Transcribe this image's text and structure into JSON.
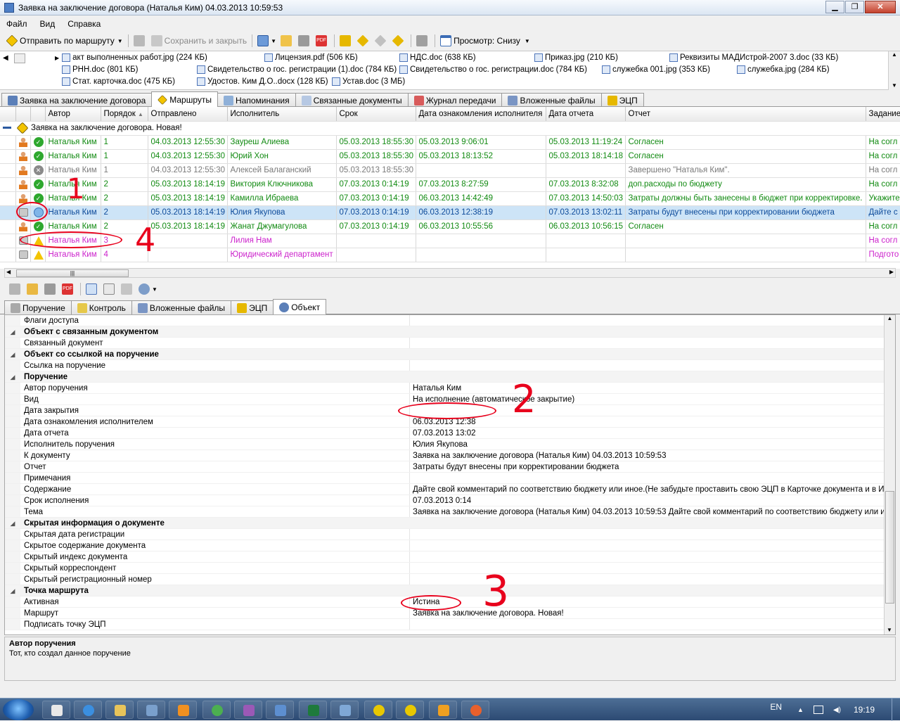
{
  "window": {
    "title": "Заявка на заключение договора (Наталья Ким) 04.03.2013 10:59:53"
  },
  "menu": [
    "Файл",
    "Вид",
    "Справка"
  ],
  "toolbar": {
    "send_route": "Отправить по маршруту",
    "save_close": "Сохранить и закрыть",
    "view": "Просмотр: Снизу"
  },
  "attachments": [
    {
      "name": "акт выполненных работ.jpg (224 КБ)"
    },
    {
      "name": "Лицензия.pdf (506 КБ)"
    },
    {
      "name": "НДС.doc (638 КБ)"
    },
    {
      "name": "Приказ.jpg (210 КБ)"
    },
    {
      "name": "Реквизиты МАДИстрой-2007 3.doc (33 КБ)"
    },
    {
      "name": "РНН.doc (801 КБ)"
    },
    {
      "name": "Свидетельство о гос. регистрации (1).doc (784 КБ)"
    },
    {
      "name": "Свидетельство о гос. регистрации.doc (784 КБ)"
    },
    {
      "name": "служебка 001.jpg (353 КБ)"
    },
    {
      "name": "служебка.jpg (284 КБ)"
    },
    {
      "name": "Стат. карточка.doc (475 КБ)"
    },
    {
      "name": "Удостов. Ким Д.О..docx (128 КБ)"
    },
    {
      "name": "Устав.doc (3 МБ)"
    }
  ],
  "main_tabs": [
    "Заявка на заключение договора",
    "Маршруты",
    "Напоминания",
    "Связанные документы",
    "Журнал передачи",
    "Вложенные файлы",
    "ЭЦП"
  ],
  "routes": {
    "columns": [
      "Автор",
      "Порядок",
      "Отправлено",
      "Исполнитель",
      "Срок",
      "Дата ознакомления исполнителя",
      "Дата отчета",
      "Отчет",
      "Задание"
    ],
    "group_title": "Заявка на заключение договора. Новая!",
    "rows": [
      {
        "status": "done",
        "author": "Наталья Ким",
        "order": "1",
        "sent": "04.03.2013 12:55:30",
        "executor": "Зауреш Алиева",
        "deadline": "05.03.2013 18:55:30",
        "read": "05.03.2013 9:06:01",
        "report_date": "05.03.2013 11:19:24",
        "report": "Согласен",
        "task": "На согл"
      },
      {
        "status": "done",
        "author": "Наталья Ким",
        "order": "1",
        "sent": "04.03.2013 12:55:30",
        "executor": "Юрий Хон",
        "deadline": "05.03.2013 18:55:30",
        "read": "05.03.2013 18:13:52",
        "report_date": "05.03.2013 18:14:18",
        "report": "Согласен",
        "task": "На согл"
      },
      {
        "status": "cancelled",
        "author": "Наталья Ким",
        "order": "1",
        "sent": "04.03.2013 12:55:30",
        "executor": "Алексей Балаганский",
        "deadline": "05.03.2013 18:55:30",
        "read": "",
        "report_date": "",
        "report": "Завершено \"Наталья Ким\".",
        "task": "На согл"
      },
      {
        "status": "done",
        "author": "Наталья Ким",
        "order": "2",
        "sent": "05.03.2013 18:14:19",
        "executor": "Виктория Ключникова",
        "deadline": "07.03.2013 0:14:19",
        "read": "07.03.2013 8:27:59",
        "report_date": "07.03.2013 8:32:08",
        "report": "доп.расходы по бюджету",
        "task": "На согл"
      },
      {
        "status": "done",
        "author": "Наталья Ким",
        "order": "2",
        "sent": "05.03.2013 18:14:19",
        "executor": "Камилла Ибраева",
        "deadline": "07.03.2013 0:14:19",
        "read": "06.03.2013 14:42:49",
        "report_date": "07.03.2013 14:50:03",
        "report": "Затраты должны быть занесены в бюджет при корректировке.",
        "task": "Укажите"
      },
      {
        "status": "selected",
        "author": "Наталья Ким",
        "order": "2",
        "sent": "05.03.2013 18:14:19",
        "executor": "Юлия Якупова",
        "deadline": "07.03.2013 0:14:19",
        "read": "06.03.2013 12:38:19",
        "report_date": "07.03.2013 13:02:11",
        "report": "Затраты будут внесены при корректировании бюджета",
        "task": "Дайте с"
      },
      {
        "status": "done",
        "author": "Наталья Ким",
        "order": "2",
        "sent": "05.03.2013 18:14:19",
        "executor": "Жанат Джумагулова",
        "deadline": "07.03.2013 0:14:19",
        "read": "06.03.2013 10:55:56",
        "report_date": "06.03.2013 10:56:15",
        "report": "Согласен",
        "task": "На согл"
      },
      {
        "status": "waiting",
        "author": "Наталья Ким",
        "order": "3",
        "sent": "",
        "executor": "Лилия Нам",
        "deadline": "",
        "read": "",
        "report_date": "",
        "report": "",
        "task": "На согл"
      },
      {
        "status": "waiting",
        "author": "Наталья Ким",
        "order": "4",
        "sent": "",
        "executor": "Юридический департамент",
        "deadline": "",
        "read": "",
        "report_date": "",
        "report": "",
        "task": "Подгото"
      }
    ]
  },
  "detail_tabs": [
    "Поручение",
    "Контроль",
    "Вложенные файлы",
    "ЭЦП",
    "Объект"
  ],
  "properties": [
    {
      "type": "item",
      "name": "Флаги доступа",
      "value": ""
    },
    {
      "type": "cat",
      "name": "Объект с связанным документом"
    },
    {
      "type": "item",
      "name": "Связанный документ",
      "value": ""
    },
    {
      "type": "cat",
      "name": "Объект со ссылкой на поручение"
    },
    {
      "type": "item",
      "name": "Ссылка на поручение",
      "value": ""
    },
    {
      "type": "cat",
      "name": "Поручение"
    },
    {
      "type": "item",
      "name": "Автор поручения",
      "value": "Наталья Ким"
    },
    {
      "type": "item",
      "name": "Вид",
      "value": "На исполнение (автоматическое закрытие)"
    },
    {
      "type": "item",
      "name": "Дата закрытия",
      "value": ""
    },
    {
      "type": "item",
      "name": "Дата ознакомления исполнителем",
      "value": "06.03.2013 12:38"
    },
    {
      "type": "item",
      "name": "Дата отчета",
      "value": "07.03.2013 13:02"
    },
    {
      "type": "item",
      "name": "Исполнитель поручения",
      "value": "Юлия Якупова"
    },
    {
      "type": "item",
      "name": "К документу",
      "value": "Заявка на заключение договора (Наталья Ким) 04.03.2013 10:59:53"
    },
    {
      "type": "item",
      "name": "Отчет",
      "value": "Затраты будут внесены при корректировании бюджета"
    },
    {
      "type": "item",
      "name": "Примечания",
      "value": ""
    },
    {
      "type": "item",
      "name": "Содержание",
      "value": "Дайте свой комментарий по соответствию бюджету или иное.(Не забудьте проставить свою ЭЦП в Карточке документа и в Испол"
    },
    {
      "type": "item",
      "name": "Срок исполнения",
      "value": "07.03.2013 0:14"
    },
    {
      "type": "item",
      "name": "Тема",
      "value": "Заявка на заключение договора (Наталья Ким) 04.03.2013 10:59:53 Дайте свой комментарий по соответствию бюджету или иное.("
    },
    {
      "type": "cat",
      "name": "Скрытая информация о документе"
    },
    {
      "type": "item",
      "name": "Скрытая дата регистрации",
      "value": ""
    },
    {
      "type": "item",
      "name": "Скрытое содержание документа",
      "value": ""
    },
    {
      "type": "item",
      "name": "Скрытый индекс документа",
      "value": ""
    },
    {
      "type": "item",
      "name": "Скрытый корреспондент",
      "value": ""
    },
    {
      "type": "item",
      "name": "Скрытый регистрационный номер",
      "value": ""
    },
    {
      "type": "cat",
      "name": "Точка маршрута"
    },
    {
      "type": "item",
      "name": "Активная",
      "value": "Истина"
    },
    {
      "type": "item",
      "name": "Маршрут",
      "value": "Заявка на заключение договора. Новая!"
    },
    {
      "type": "item",
      "name": "Подписать точку ЭЦП",
      "value": ""
    }
  ],
  "description": {
    "title": "Автор поручения",
    "text": "Тот, кто создал данное поручение"
  },
  "taskbar": {
    "lang": "EN",
    "time": "19:19"
  },
  "annotations": [
    "1",
    "4",
    "2",
    "3"
  ],
  "colors": {
    "done": "#118a11",
    "waiting": "#cc22cc",
    "selected": "#cde4f7",
    "annotation": "#e8001c"
  }
}
